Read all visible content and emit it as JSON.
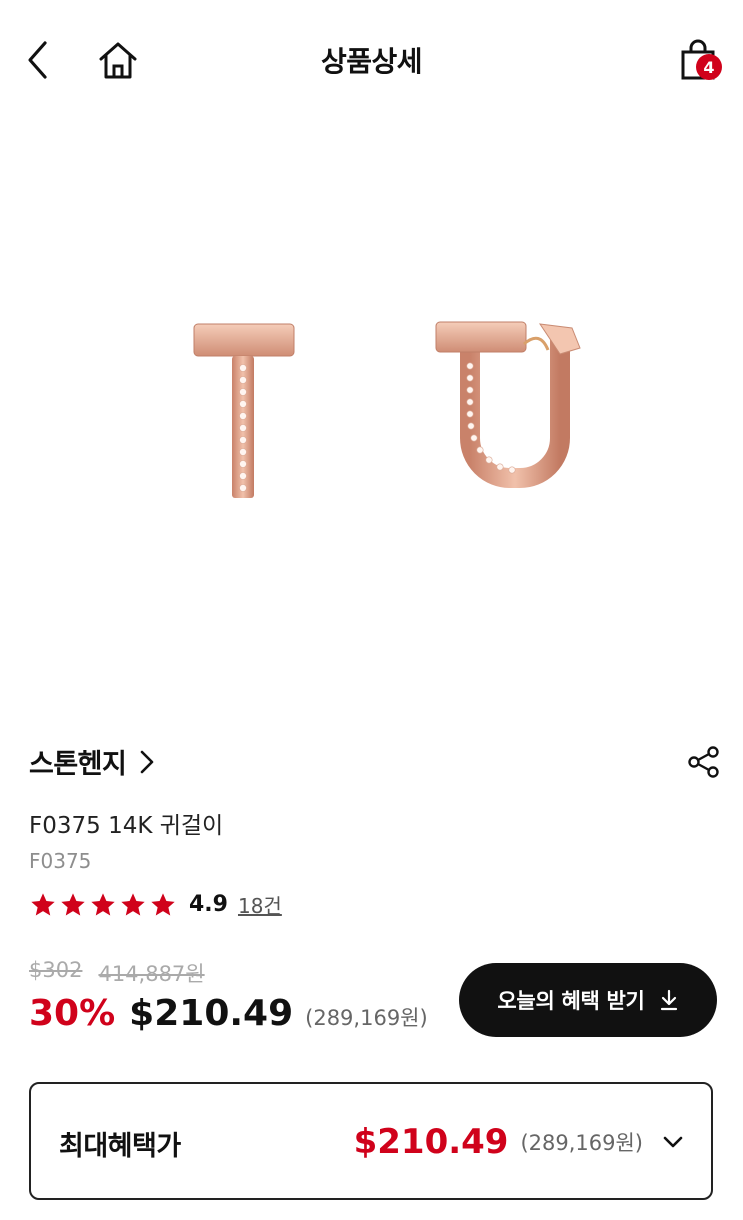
{
  "header": {
    "title": "상품상세",
    "cart_count": "4",
    "icons": {
      "back": "chevron-left-icon",
      "home": "home-icon",
      "cart": "shopping-bag-icon"
    }
  },
  "product": {
    "image": "rose-gold-earrings-image",
    "brand": "스톤헨지",
    "name": "F0375 14K 귀걸이",
    "code": "F0375",
    "rating": {
      "stars": 5,
      "score": "4.9",
      "reviews": "18건"
    },
    "original_price_usd": "$302",
    "original_price_krw": "414,887원",
    "discount": "30%",
    "sale_price_usd": "$210.49",
    "sale_price_krw": "(289,169원)",
    "benefit_button": "오늘의 혜택 받기"
  },
  "max_benefit": {
    "label": "최대혜택가",
    "price_usd": "$210.49",
    "price_krw": "(289,169원)"
  },
  "colors": {
    "accent": "#d0021b",
    "dark": "#111111",
    "rose_gold": "#e2a58c"
  }
}
